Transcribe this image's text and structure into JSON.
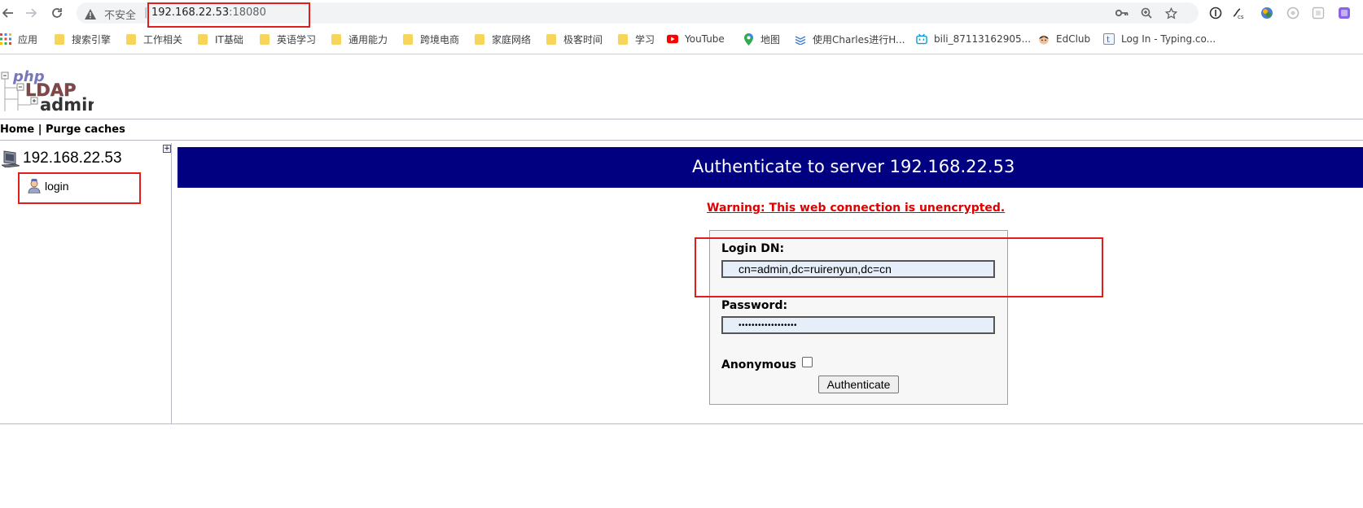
{
  "browser": {
    "security_label": "不安全",
    "url_host": "192.168.22.53",
    "url_port": ":18080"
  },
  "bookmarks": [
    {
      "label": "应用",
      "icon": "apps-grid-icon"
    },
    {
      "label": "搜索引擎",
      "icon": "folder-icon"
    },
    {
      "label": "工作相关",
      "icon": "folder-icon"
    },
    {
      "label": "IT基础",
      "icon": "folder-icon"
    },
    {
      "label": "英语学习",
      "icon": "folder-icon"
    },
    {
      "label": "通用能力",
      "icon": "folder-icon"
    },
    {
      "label": "跨境电商",
      "icon": "folder-icon"
    },
    {
      "label": "家庭网络",
      "icon": "folder-icon"
    },
    {
      "label": "极客时间",
      "icon": "folder-icon"
    },
    {
      "label": "学习",
      "icon": "folder-icon"
    },
    {
      "label": "YouTube",
      "icon": "youtube-icon"
    },
    {
      "label": "地图",
      "icon": "maps-pin-icon"
    },
    {
      "label": "使用Charles进行H...",
      "icon": "layers-icon"
    },
    {
      "label": "bili_87113162905...",
      "icon": "bilibili-icon"
    },
    {
      "label": "EdClub",
      "icon": "edclub-icon"
    },
    {
      "label": "Log In - Typing.co...",
      "icon": "typing-icon"
    }
  ],
  "menu": {
    "home": "Home",
    "separator": "|",
    "purge": "Purge caches"
  },
  "tree": {
    "server": "192.168.22.53",
    "login": "login"
  },
  "main": {
    "title": "Authenticate to server 192.168.22.53",
    "warning": "Warning: This web connection is unencrypted.",
    "login_dn_label": "Login DN:",
    "login_dn_value": "cn=admin,dc=ruirenyun,dc=cn",
    "password_label": "Password:",
    "password_value": "••••••••••••••••••",
    "anonymous_label": "Anonymous",
    "authenticate_button": "Authenticate"
  },
  "colors": {
    "banner": "#000080",
    "warning": "#e00000",
    "highlight": "#e01e1e"
  }
}
